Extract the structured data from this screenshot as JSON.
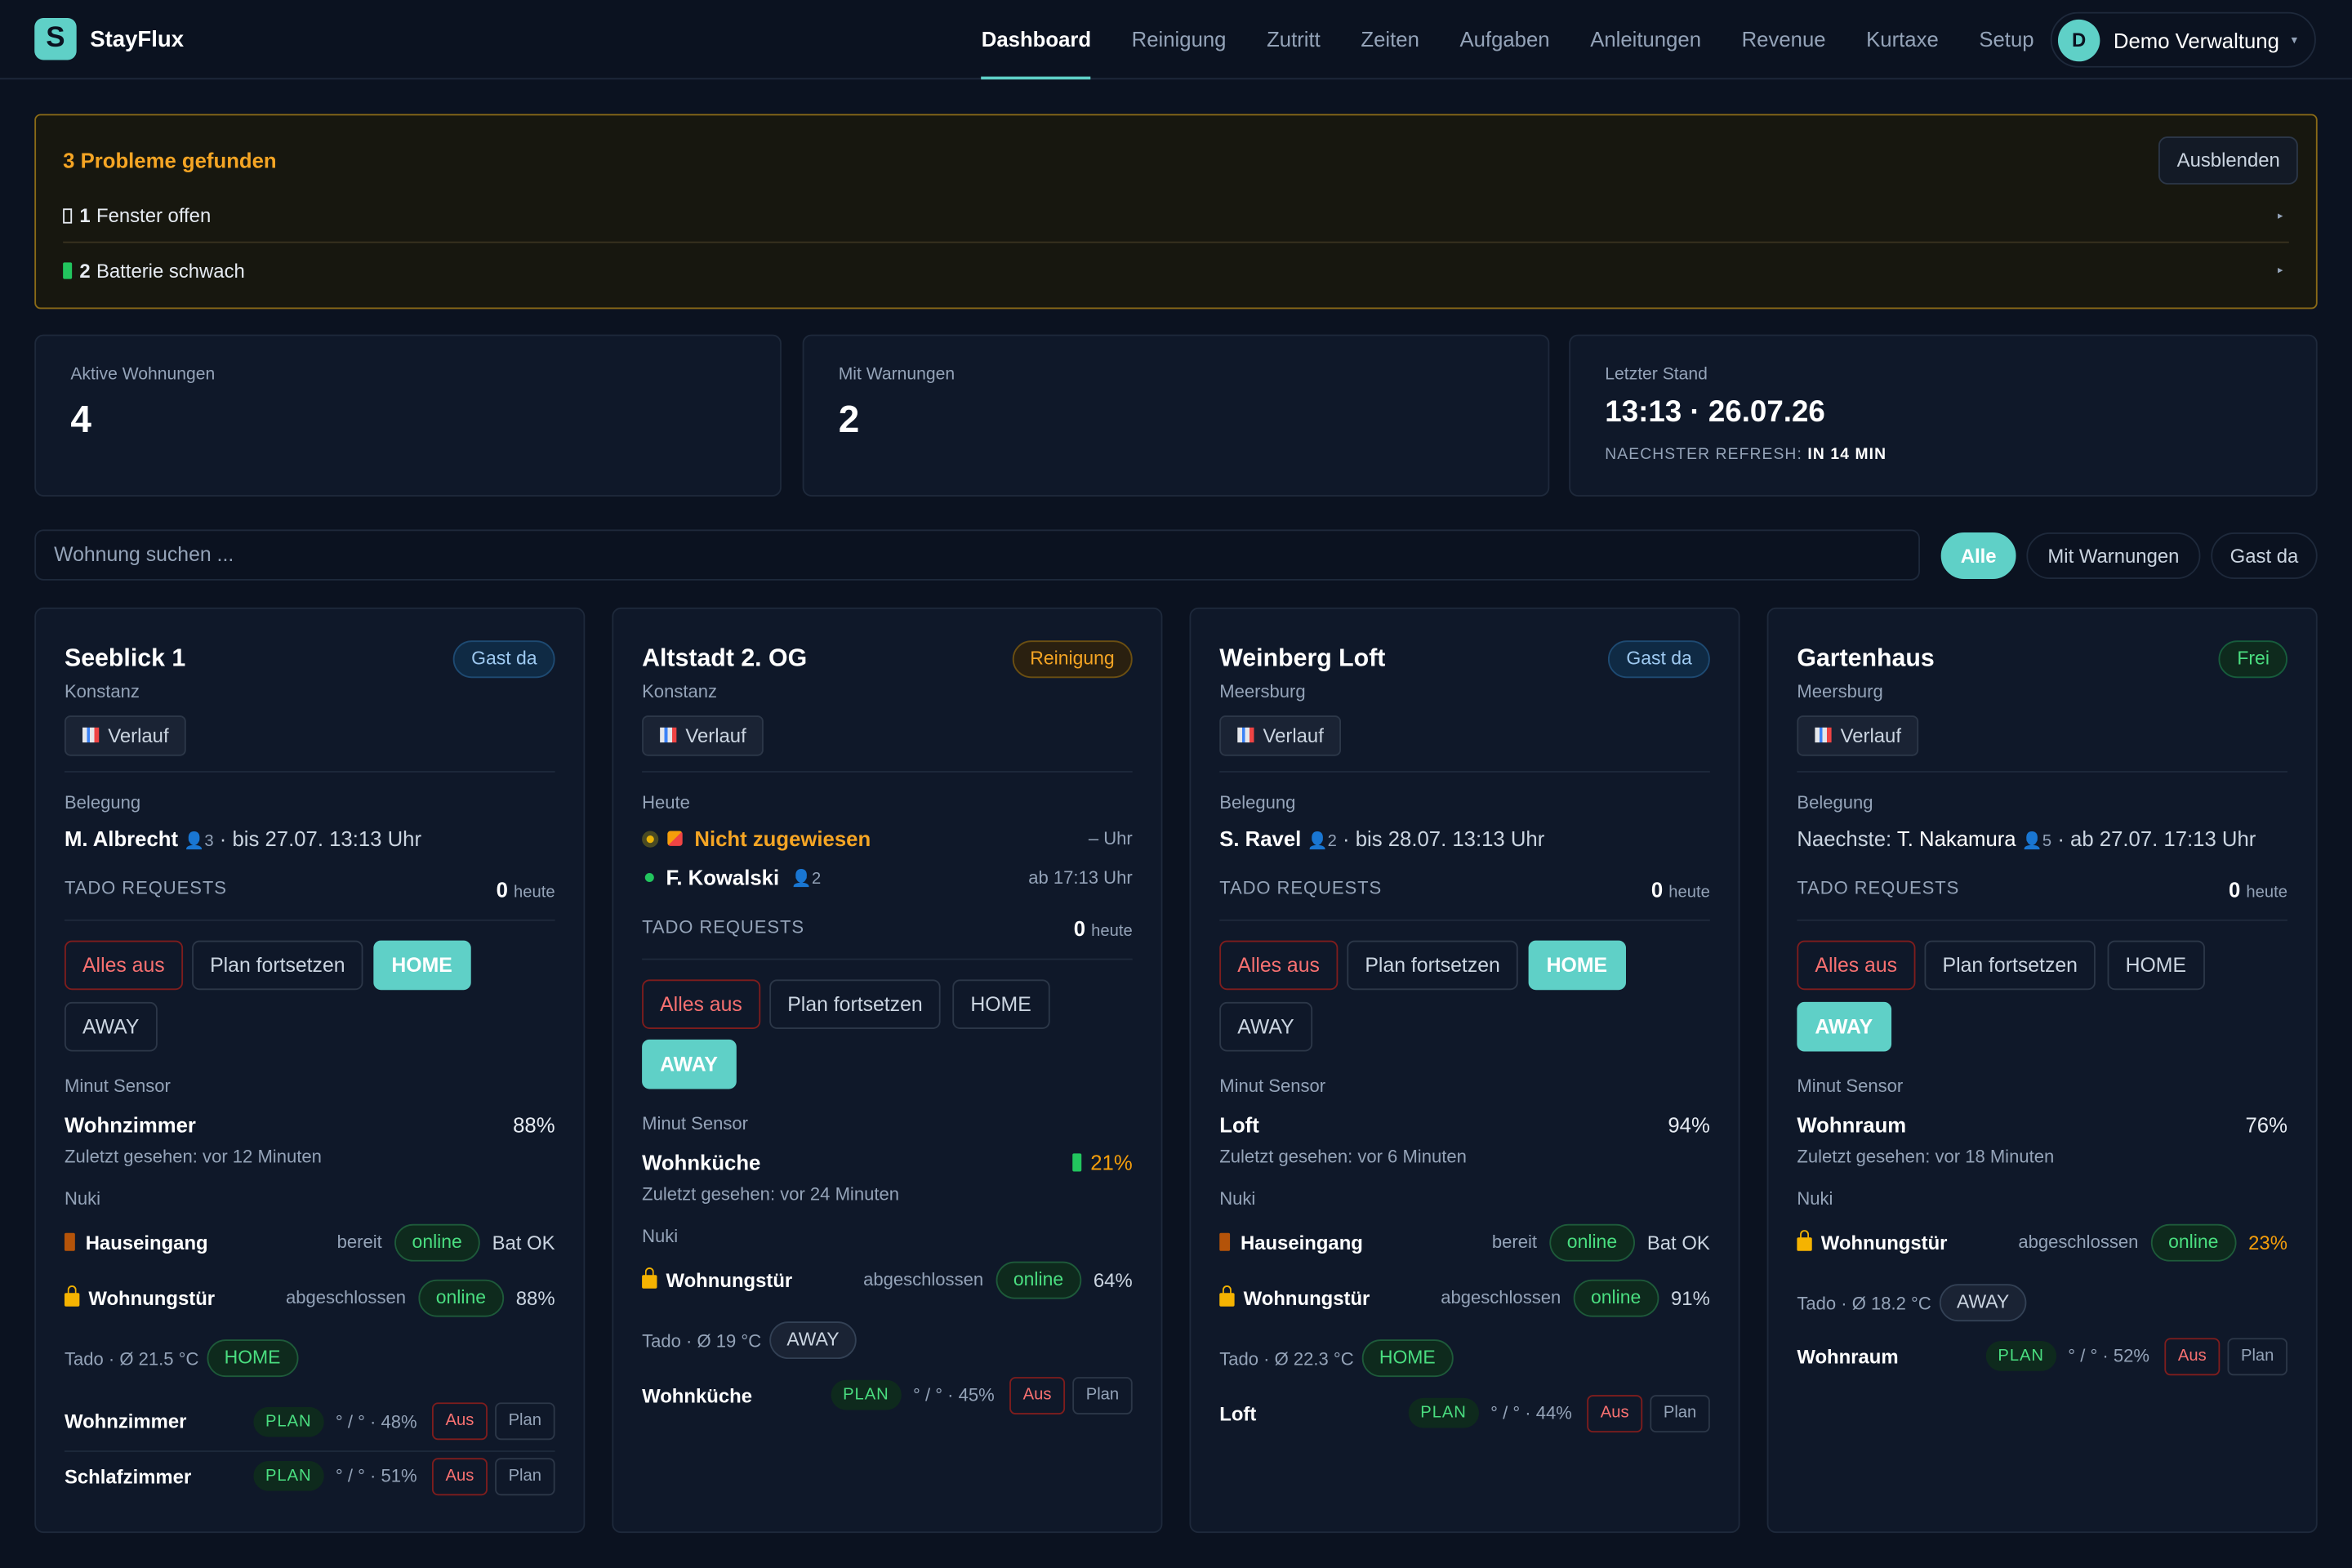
{
  "app": {
    "brand": "StayFlux",
    "logo_letter": "S"
  },
  "nav": {
    "items": [
      "Dashboard",
      "Reinigung",
      "Zutritt",
      "Zeiten",
      "Aufgaben",
      "Anleitungen",
      "Revenue",
      "Kurtaxe",
      "Setup"
    ],
    "active": "Dashboard",
    "user": {
      "initial": "D",
      "name": "Demo Verwaltung"
    }
  },
  "alert": {
    "title": "3 Probleme gefunden",
    "hide_label": "Ausblenden",
    "rows": [
      {
        "count": "1",
        "text": "Fenster offen"
      },
      {
        "count": "2",
        "text": "Batterie schwach"
      }
    ]
  },
  "stats": {
    "active": {
      "label": "Aktive Wohnungen",
      "value": "4"
    },
    "warnings": {
      "label": "Mit Warnungen",
      "value": "2"
    },
    "last": {
      "label": "Letzter Stand",
      "value": "13:13 · 26.07.26",
      "sub_label": "NAECHSTER REFRESH:",
      "sub_value": "IN 14 MIN"
    }
  },
  "search": {
    "placeholder": "Wohnung suchen ..."
  },
  "filters": [
    "Alle",
    "Mit Warnungen",
    "Gast da"
  ],
  "common": {
    "verlauf": "Verlauf",
    "belegung": "Belegung",
    "heute": "Heute",
    "tado_requests": "TADO REQUESTS",
    "heute_small": "heute",
    "alles_aus": "Alles aus",
    "plan_fortsetzen": "Plan fortsetzen",
    "home": "HOME",
    "away": "AWAY",
    "minut_sensor": "Minut Sensor",
    "nuki": "Nuki",
    "online": "online",
    "plan": "PLAN",
    "aus": "Aus",
    "plan_btn": "Plan"
  },
  "cards": [
    {
      "name": "Seeblick 1",
      "city": "Konstanz",
      "badge": "Gast da",
      "guest": "M. Albrecht",
      "persons": "3",
      "period": "· bis 27.07. 13:13 Uhr",
      "tado_count": "0",
      "sensor": {
        "room": "Wohnzimmer",
        "value": "88%",
        "seen": "Zuletzt gesehen: vor 12 Minuten"
      },
      "nuki": [
        {
          "name": "Hauseingang",
          "state": "bereit",
          "status": "online",
          "battery": "Bat OK"
        },
        {
          "name": "Wohnungstür",
          "state": "abgeschlossen",
          "status": "online",
          "battery": "88%"
        }
      ],
      "tado": {
        "label": "Tado · Ø 21.5 °C",
        "mode": "HOME"
      },
      "rooms": [
        {
          "name": "Wohnzimmer",
          "temp": "° / ° · 48%"
        },
        {
          "name": "Schlafzimmer",
          "temp": "° / ° · 51%"
        }
      ]
    },
    {
      "name": "Altstadt 2. OG",
      "city": "Konstanz",
      "badge": "Reinigung",
      "cleaning": {
        "status": "Nicht zugewiesen",
        "time": "– Uhr"
      },
      "guest": "F. Kowalski",
      "persons": "2",
      "arrival": "ab 17:13 Uhr",
      "tado_count": "0",
      "sensor": {
        "room": "Wohnküche",
        "value": "21%",
        "seen": "Zuletzt gesehen: vor 24 Minuten"
      },
      "nuki": [
        {
          "name": "Wohnungstür",
          "state": "abgeschlossen",
          "status": "online",
          "battery": "64%"
        }
      ],
      "tado": {
        "label": "Tado · Ø 19 °C",
        "mode": "AWAY"
      },
      "rooms": [
        {
          "name": "Wohnküche",
          "temp": "° / ° · 45%"
        }
      ]
    },
    {
      "name": "Weinberg Loft",
      "city": "Meersburg",
      "badge": "Gast da",
      "guest": "S. Ravel",
      "persons": "2",
      "period": "· bis 28.07. 13:13 Uhr",
      "tado_count": "0",
      "sensor": {
        "room": "Loft",
        "value": "94%",
        "seen": "Zuletzt gesehen: vor 6 Minuten"
      },
      "nuki": [
        {
          "name": "Hauseingang",
          "state": "bereit",
          "status": "online",
          "battery": "Bat OK"
        },
        {
          "name": "Wohnungstür",
          "state": "abgeschlossen",
          "status": "online",
          "battery": "91%"
        }
      ],
      "tado": {
        "label": "Tado · Ø 22.3 °C",
        "mode": "HOME"
      },
      "rooms": [
        {
          "name": "Loft",
          "temp": "° / ° · 44%"
        }
      ]
    },
    {
      "name": "Gartenhaus",
      "city": "Meersburg",
      "badge": "Frei",
      "next_label": "Naechste:",
      "guest": "T. Nakamura",
      "persons": "5",
      "period": "· ab 27.07. 17:13 Uhr",
      "tado_count": "0",
      "sensor": {
        "room": "Wohnraum",
        "value": "76%",
        "seen": "Zuletzt gesehen: vor 18 Minuten"
      },
      "nuki": [
        {
          "name": "Wohnungstür",
          "state": "abgeschlossen",
          "status": "online",
          "battery": "23%"
        }
      ],
      "tado": {
        "label": "Tado · Ø 18.2 °C",
        "mode": "AWAY"
      },
      "rooms": [
        {
          "name": "Wohnraum",
          "temp": "° / ° · 52%"
        }
      ]
    }
  ],
  "colors": {
    "bg": "#0b1220",
    "card": "#0f1829",
    "accent": "#5fd0c7",
    "warn": "#f5a524",
    "ok": "#4ade80",
    "danger": "#f87171"
  }
}
